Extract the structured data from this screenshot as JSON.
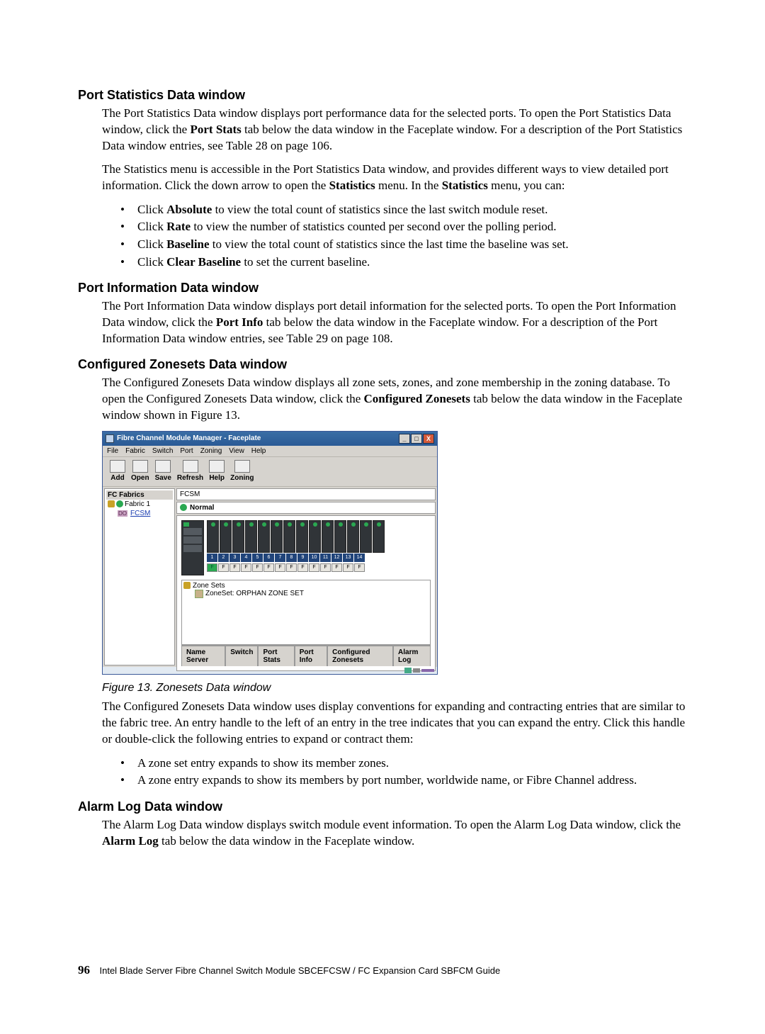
{
  "sections": {
    "port_stats": {
      "title": "Port Statistics Data window",
      "p1a": "The Port Statistics Data window displays port performance data for the selected ports. To open the Port Statistics Data window, click the ",
      "p1b": "Port Stats",
      "p1c": " tab below the data window in the Faceplate window. For a description of the Port Statistics Data window entries, see Table 28 on page 106.",
      "p2a": "The Statistics menu is accessible in the Port Statistics Data window, and provides different ways to view detailed port information. Click the down arrow to open the ",
      "p2b": "Statistics",
      "p2c": " menu. In the ",
      "p2d": "Statistics",
      "p2e": " menu, you can:",
      "bullets": [
        {
          "pre": "Click ",
          "bold": "Absolute",
          "post": " to view the total count of statistics since the last switch module reset."
        },
        {
          "pre": "Click ",
          "bold": "Rate",
          "post": " to view the number of statistics counted per second over the polling period."
        },
        {
          "pre": "Click ",
          "bold": "Baseline",
          "post": " to view the total count of statistics since the last time the baseline was set."
        },
        {
          "pre": "Click ",
          "bold": "Clear Baseline",
          "post": " to set the current baseline."
        }
      ]
    },
    "port_info": {
      "title": "Port Information Data window",
      "p1a": "The Port Information Data window displays port detail information for the selected ports. To open the Port Information Data window, click the ",
      "p1b": "Port Info",
      "p1c": " tab below the data window in the Faceplate window. For a description of the Port Information Data window entries, see Table 29 on page 108."
    },
    "zonesets": {
      "title": "Configured Zonesets Data window",
      "p1a": "The Configured Zonesets Data window displays all zone sets, zones, and zone membership in the zoning database. To open the Configured Zonesets Data window, click the ",
      "p1b": "Configured Zonesets",
      "p1c": " tab below the data window in the Faceplate window shown in Figure 13.",
      "caption": "Figure 13. Zonesets Data window",
      "p2": "The Configured Zonesets Data window uses display conventions for expanding and contracting entries that are similar to the fabric tree. An entry handle to the left of an entry in the tree indicates that you can expand the entry. Click this handle or double-click the following entries to expand or contract them:",
      "bullets": [
        "A zone set entry expands to show its member zones.",
        "A zone entry expands to show its members by port number, worldwide name, or Fibre Channel address."
      ]
    },
    "alarm": {
      "title": "Alarm Log Data window",
      "p1a": "The Alarm Log Data window displays switch module event information. To open the Alarm Log Data window, click the ",
      "p1b": "Alarm Log",
      "p1c": " tab below the data window in the Faceplate window."
    }
  },
  "screenshot": {
    "title": "Fibre Channel Module Manager - Faceplate",
    "menu": [
      "File",
      "Fabric",
      "Switch",
      "Port",
      "Zoning",
      "View",
      "Help"
    ],
    "toolbar": [
      "Add",
      "Open",
      "Save",
      "Refresh",
      "Help",
      "Zoning"
    ],
    "sidebar_header": "FC Fabrics",
    "fabric_label": "Fabric 1",
    "fcsm_badge": "DO",
    "fcsm_label": "FCSM",
    "status_name": "FCSM",
    "status_text": "Normal",
    "port_numbers": [
      "1",
      "2",
      "3",
      "4",
      "5",
      "6",
      "7",
      "8",
      "9",
      "10",
      "11",
      "12",
      "13",
      "14"
    ],
    "port_types": [
      "F",
      "F",
      "F",
      "F",
      "F",
      "F",
      "F",
      "F",
      "F",
      "F",
      "F",
      "F",
      "F",
      "F"
    ],
    "zone_sets_label": "Zone Sets",
    "zone_set_entry": "ZoneSet: ORPHAN ZONE SET",
    "tabs": [
      "Name Server",
      "Switch",
      "Port Stats",
      "Port Info",
      "Configured Zonesets",
      "Alarm Log"
    ]
  },
  "footer": {
    "page": "96",
    "text": "Intel Blade Server Fibre Channel Switch Module SBCEFCSW / FC Expansion Card SBFCM Guide"
  }
}
